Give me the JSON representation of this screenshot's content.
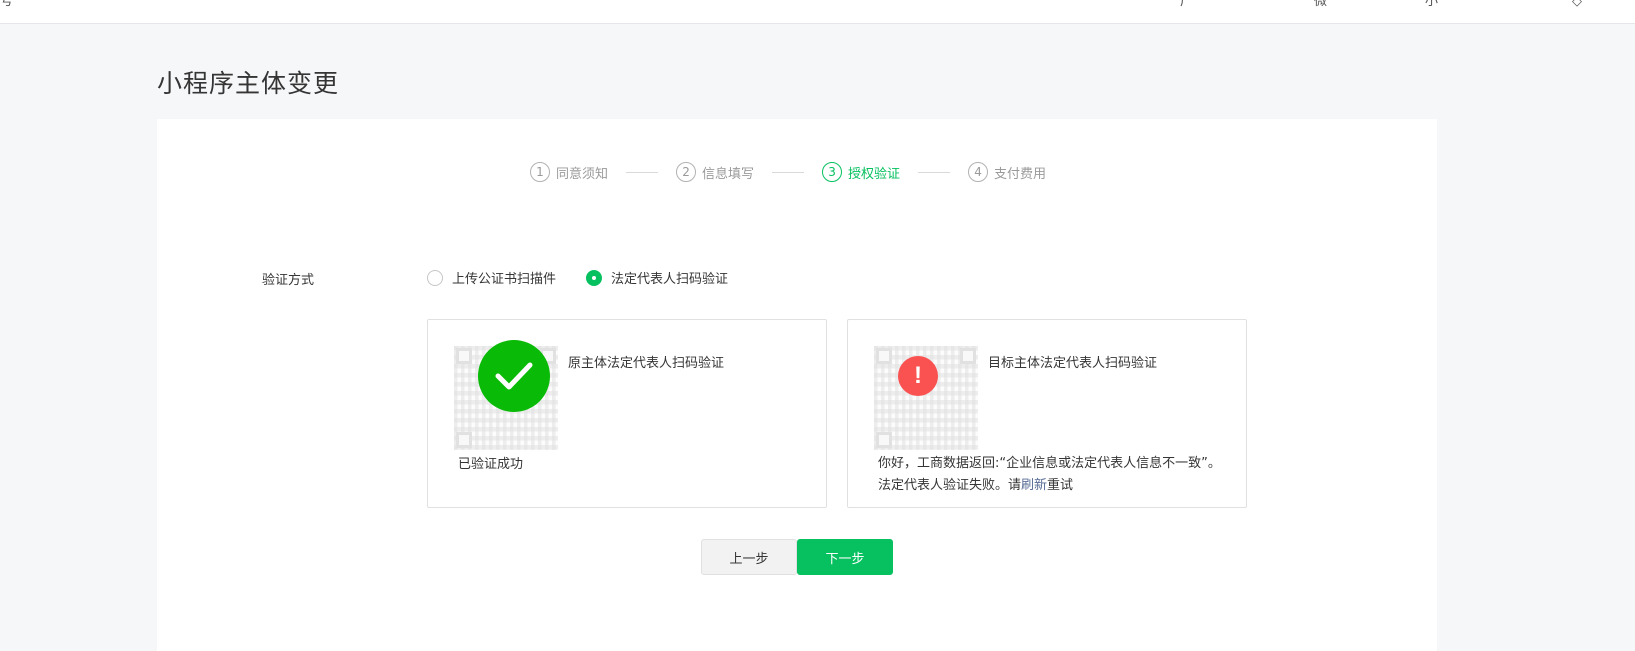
{
  "topbar": {
    "fragments": [
      "号",
      "广",
      "微",
      "小",
      "◇"
    ]
  },
  "page": {
    "title": "小程序主体变更"
  },
  "steps": [
    {
      "num": "1",
      "label": "同意须知",
      "state": "done"
    },
    {
      "num": "2",
      "label": "信息填写",
      "state": "done"
    },
    {
      "num": "3",
      "label": "授权验证",
      "state": "active"
    },
    {
      "num": "4",
      "label": "支付费用",
      "state": "todo"
    }
  ],
  "form": {
    "verify_label": "验证方式",
    "options": [
      {
        "label": "上传公证书扫描件",
        "checked": false
      },
      {
        "label": "法定代表人扫码验证",
        "checked": true
      }
    ]
  },
  "cards": {
    "original": {
      "title": "原主体法定代表人扫码验证",
      "status": "已验证成功",
      "icon": "check-circle-icon"
    },
    "target": {
      "title": "目标主体法定代表人扫码验证",
      "message_prefix": "你好，工商数据返回:“企业信息或法定代表人信息不一致”。法定代表人验证失败。请",
      "refresh_link": "刷新",
      "message_suffix": "重试",
      "icon": "warning-circle-icon"
    }
  },
  "buttons": {
    "prev": "上一步",
    "next": "下一步"
  },
  "colors": {
    "accent": "#07c160",
    "success": "#09bb07",
    "error": "#fa5151",
    "link": "#576b95"
  }
}
